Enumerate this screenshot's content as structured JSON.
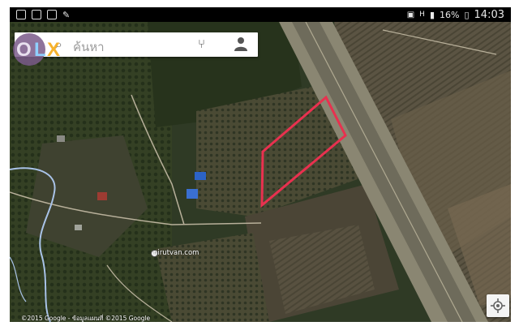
{
  "status_bar": {
    "time": "14:03",
    "battery": "16%",
    "network_h": "H",
    "network_n": "N"
  },
  "search": {
    "placeholder": "ค้นหา",
    "icons": [
      "menu-icon",
      "search-icon",
      "directions-icon",
      "account-icon"
    ]
  },
  "watermark": {
    "logo_text": "OLX"
  },
  "map": {
    "pin_label": "nirutvan.com",
    "copyright": "©2015 Google - ข้อมูลแผนที่ ©2015 Google",
    "highlight_color": "#e8314f"
  }
}
